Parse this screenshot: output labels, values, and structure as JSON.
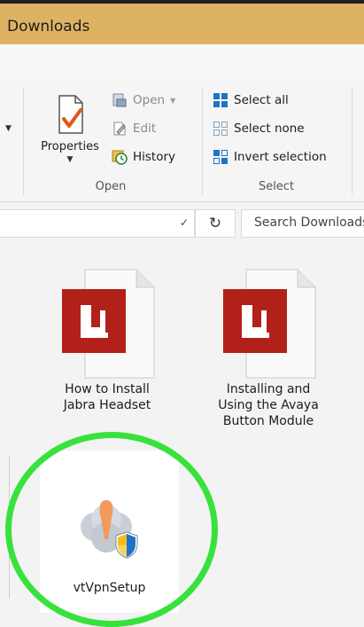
{
  "window": {
    "title": "Downloads"
  },
  "ribbon": {
    "properties_label": "Properties",
    "open_group": {
      "open_label": "Open",
      "edit_label": "Edit",
      "history_label": "History",
      "group_label": "Open"
    },
    "select_group": {
      "select_all_label": "Select all",
      "select_none_label": "Select none",
      "invert_selection_label": "Invert selection",
      "group_label": "Select"
    }
  },
  "address_bar": {
    "search_placeholder": "Search Downloads"
  },
  "files": [
    {
      "name_line1": "How to Install",
      "name_line2": "Jabra Headset",
      "icon": "pdf-icon"
    },
    {
      "name_line1": "Installing and",
      "name_line2": "Using the Avaya",
      "name_line3": "Button Module",
      "icon": "pdf-icon"
    },
    {
      "name": "vtVpnSetup",
      "icon": "installer-icon",
      "selected": true
    }
  ],
  "highlight_color": "#38e23c",
  "title_bar_color": "#ddb363",
  "pdf_color": "#b2201a"
}
